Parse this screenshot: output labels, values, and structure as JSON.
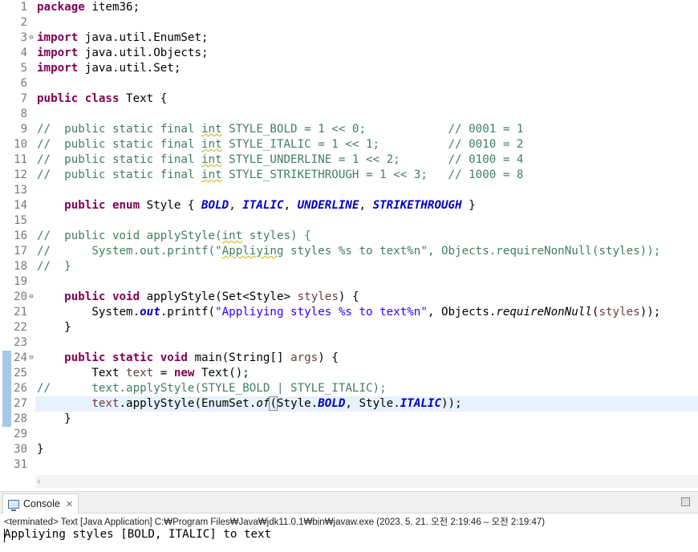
{
  "editor": {
    "lines": [
      {
        "n": "1",
        "t": [
          [
            "kw",
            "package"
          ],
          [
            "",
            "item36;"
          ]
        ]
      },
      {
        "n": "2",
        "t": []
      },
      {
        "n": "3",
        "t": [
          [
            "kw",
            "import"
          ],
          [
            "",
            "java.util.EnumSet;"
          ]
        ]
      },
      {
        "n": "4",
        "t": [
          [
            "kw",
            "import"
          ],
          [
            "",
            "java.util.Objects;"
          ]
        ]
      },
      {
        "n": "5",
        "t": [
          [
            "kw",
            "import"
          ],
          [
            "",
            "java.util.Set;"
          ]
        ]
      },
      {
        "n": "6",
        "t": []
      },
      {
        "n": "7",
        "t": [
          [
            "kw",
            "public"
          ],
          [
            "",
            " "
          ],
          [
            "kw",
            "class"
          ],
          [
            "",
            " Text {"
          ]
        ]
      },
      {
        "n": "8",
        "t": []
      },
      {
        "n": "9",
        "t": [
          [
            "cm",
            "//  public static final "
          ],
          [
            "cm sq",
            "int"
          ],
          [
            "cm",
            " STYLE_BOLD = 1 << 0;            // 0001 = 1"
          ]
        ]
      },
      {
        "n": "10",
        "t": [
          [
            "cm",
            "//  public static final "
          ],
          [
            "cm sq",
            "int"
          ],
          [
            "cm",
            " STYLE_ITALIC = 1 << 1;          // 0010 = 2"
          ]
        ]
      },
      {
        "n": "11",
        "t": [
          [
            "cm",
            "//  public static final "
          ],
          [
            "cm sq",
            "int"
          ],
          [
            "cm",
            " STYLE_UNDERLINE = 1 << 2;       // 0100 = 4"
          ]
        ]
      },
      {
        "n": "12",
        "t": [
          [
            "cm",
            "//  public static final "
          ],
          [
            "cm sq",
            "int"
          ],
          [
            "cm",
            " STYLE_STRIKETHROUGH = 1 << 3;   // 1000 = 8"
          ]
        ]
      },
      {
        "n": "13",
        "t": []
      },
      {
        "n": "14",
        "t": [
          [
            "",
            "    "
          ],
          [
            "kw",
            "public"
          ],
          [
            "",
            " "
          ],
          [
            "kw",
            "enum"
          ],
          [
            "",
            " Style { "
          ],
          [
            "ef",
            "BOLD"
          ],
          [
            "",
            ", "
          ],
          [
            "ef",
            "ITALIC"
          ],
          [
            "",
            ", "
          ],
          [
            "ef",
            "UNDERLINE"
          ],
          [
            "",
            ", "
          ],
          [
            "ef",
            "STRIKETHROUGH"
          ],
          [
            "",
            " }"
          ]
        ]
      },
      {
        "n": "15",
        "t": []
      },
      {
        "n": "16",
        "t": [
          [
            "cm",
            "//  public void applyStyle("
          ],
          [
            "cm sq",
            "int"
          ],
          [
            "cm",
            " styles) {"
          ]
        ]
      },
      {
        "n": "17",
        "t": [
          [
            "cm",
            "//      System.out.printf(\""
          ],
          [
            "cm sq",
            "Appliying"
          ],
          [
            "cm",
            " styles %s to text%n\", Objects.requireNonNull(styles));"
          ]
        ]
      },
      {
        "n": "18",
        "t": [
          [
            "cm",
            "//  }"
          ]
        ]
      },
      {
        "n": "19",
        "t": []
      },
      {
        "n": "20",
        "t": [
          [
            "",
            "    "
          ],
          [
            "kw",
            "public"
          ],
          [
            "",
            " "
          ],
          [
            "kw",
            "void"
          ],
          [
            "",
            " applyStyle(Set<Style> "
          ],
          [
            "par",
            "styles"
          ],
          [
            "",
            ") {"
          ]
        ]
      },
      {
        "n": "21",
        "t": [
          [
            "",
            "        System."
          ],
          [
            "sf",
            "out"
          ],
          [
            "",
            ".printf("
          ],
          [
            "str",
            "\"Appliying styles %s to text%n\""
          ],
          [
            "",
            ", Objects."
          ],
          [
            "sm",
            "requireNonNull"
          ],
          [
            "",
            "("
          ],
          [
            "par",
            "styles"
          ],
          [
            "",
            "));"
          ]
        ]
      },
      {
        "n": "22",
        "t": [
          [
            "",
            "    }"
          ]
        ]
      },
      {
        "n": "23",
        "t": []
      },
      {
        "n": "24",
        "t": [
          [
            "",
            "    "
          ],
          [
            "kw",
            "public"
          ],
          [
            "",
            " "
          ],
          [
            "kw",
            "static"
          ],
          [
            "",
            " "
          ],
          [
            "kw",
            "void"
          ],
          [
            "",
            " main(String[] "
          ],
          [
            "par",
            "args"
          ],
          [
            "",
            ") {"
          ]
        ]
      },
      {
        "n": "25",
        "t": [
          [
            "",
            "        Text "
          ],
          [
            "par",
            "text"
          ],
          [
            "",
            " = "
          ],
          [
            "kw",
            "new"
          ],
          [
            "",
            " Text();"
          ]
        ]
      },
      {
        "n": "26",
        "t": [
          [
            "cm",
            "//      text.applyStyle(STYLE_BOLD | STYLE_ITALIC);"
          ]
        ]
      },
      {
        "n": "27",
        "t": [
          [
            "",
            "        "
          ],
          [
            "par",
            "text"
          ],
          [
            "",
            ".applyStyle(EnumSet."
          ],
          [
            "sm",
            "of"
          ],
          [
            "bm",
            "("
          ],
          [
            "",
            "Style."
          ],
          [
            "ef",
            "BOLD"
          ],
          [
            "",
            ", Style."
          ],
          [
            "ef",
            "ITALIC"
          ],
          [
            "",
            "));"
          ]
        ]
      },
      {
        "n": "28",
        "t": [
          [
            "",
            "    }"
          ]
        ]
      },
      {
        "n": "29",
        "t": []
      },
      {
        "n": "30",
        "t": [
          [
            "",
            "}"
          ]
        ]
      },
      {
        "n": "31",
        "t": []
      }
    ],
    "fold_lines": [
      "3",
      "20",
      "24"
    ],
    "changed_lines": [
      "24",
      "25",
      "26",
      "27",
      "28"
    ],
    "current_line": "27"
  },
  "console": {
    "tab_label": "Console",
    "tab_close": "✕",
    "description": "<terminated> Text [Java Application] C:₩Program Files₩Java₩jdk11.0.1₩bin₩javaw.exe  (2023. 5. 21. 오전 2:19:46 – 오전 2:19:47)",
    "output": "Appliying styles [BOLD, ITALIC] to text"
  },
  "icons": {
    "fold": "collapse-minus-icon",
    "scroll_left": "chevron-left-icon",
    "console": "console-icon",
    "minimize": "minimize-icon"
  }
}
